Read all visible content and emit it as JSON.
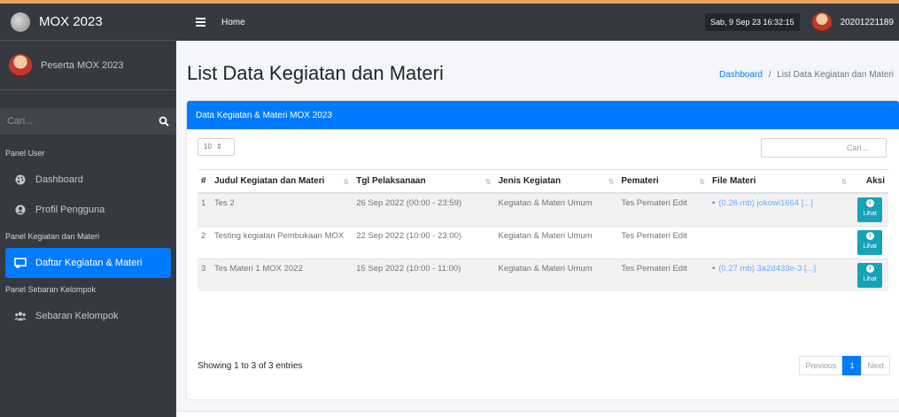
{
  "colors": {
    "accent": "#007bff",
    "sidebar": "#343a40",
    "info_button": "#17a2b8",
    "top_strip": "#e8a35a"
  },
  "brand": {
    "title": "MOX 2023",
    "logo_icon": "seal-logo-icon"
  },
  "user_panel": {
    "name": "Peserta MOX 2023"
  },
  "sidebar": {
    "search_placeholder": "Cari...",
    "sections": [
      {
        "header": "Panel User",
        "items": [
          {
            "label": "Dashboard",
            "icon": "palette-icon"
          },
          {
            "label": "Profil Pengguna",
            "icon": "user-circle-icon"
          }
        ]
      },
      {
        "header": "Panel Kegiatan dan Materi",
        "items": [
          {
            "label": "Daftar Kegiatan & Materi",
            "icon": "chalkboard-icon",
            "active": true
          }
        ]
      },
      {
        "header": "Panel Sebaran Kelompok",
        "items": [
          {
            "label": "Sebaran Kelompok",
            "icon": "users-icon"
          }
        ]
      }
    ]
  },
  "navbar": {
    "home_label": "Home",
    "datetime": "Sab, 9 Sep 23 16:32:15",
    "user_id": "20201221189"
  },
  "page": {
    "title": "List Data Kegiatan dan Materi",
    "breadcrumb": {
      "home": "Dashboard",
      "separator": "/",
      "current": "List Data Kegiatan dan Materi"
    }
  },
  "card": {
    "title": "Data Kegiatan & Materi MOX 2023",
    "length_value": "10",
    "search_placeholder": "Cari...",
    "columns": [
      "#",
      "Judul Kegiatan dan Materi",
      "Tgl Pelaksanaan",
      "Jenis Kegiatan",
      "Pemateri",
      "File Materi",
      "Aksi"
    ],
    "rows": [
      {
        "no": "1",
        "judul": "Tes 2",
        "tgl": "26 Sep 2022 (00:00 - 23:59)",
        "jenis": "Kegiatan & Materi Umum",
        "pemateri": "Tes Pemateri Edit",
        "file": "(0.26 mb) jokowi1664 [...]",
        "action": "Lihat"
      },
      {
        "no": "2",
        "judul": "Testing kegiatan Pembukaan MOX",
        "tgl": "22 Sep 2022 (10:00 - 23:00)",
        "jenis": "Kegiatan & Materi Umum",
        "pemateri": "Tes Pemateri Edit",
        "file": "",
        "action": "Lihat"
      },
      {
        "no": "3",
        "judul": "Tes Materi 1 MOX 2022",
        "tgl": "15 Sep 2022 (10:00 - 11:00)",
        "jenis": "Kegiatan & Materi Umum",
        "pemateri": "Tes Pemateri Edit",
        "file": "(0.27 mb) 3a2d433e-3 [...]",
        "action": "Lihat"
      }
    ],
    "info": "Showing 1 to 3 of 3 entries",
    "pagination": {
      "previous": "Previous",
      "current": "1",
      "next": "Next"
    }
  }
}
